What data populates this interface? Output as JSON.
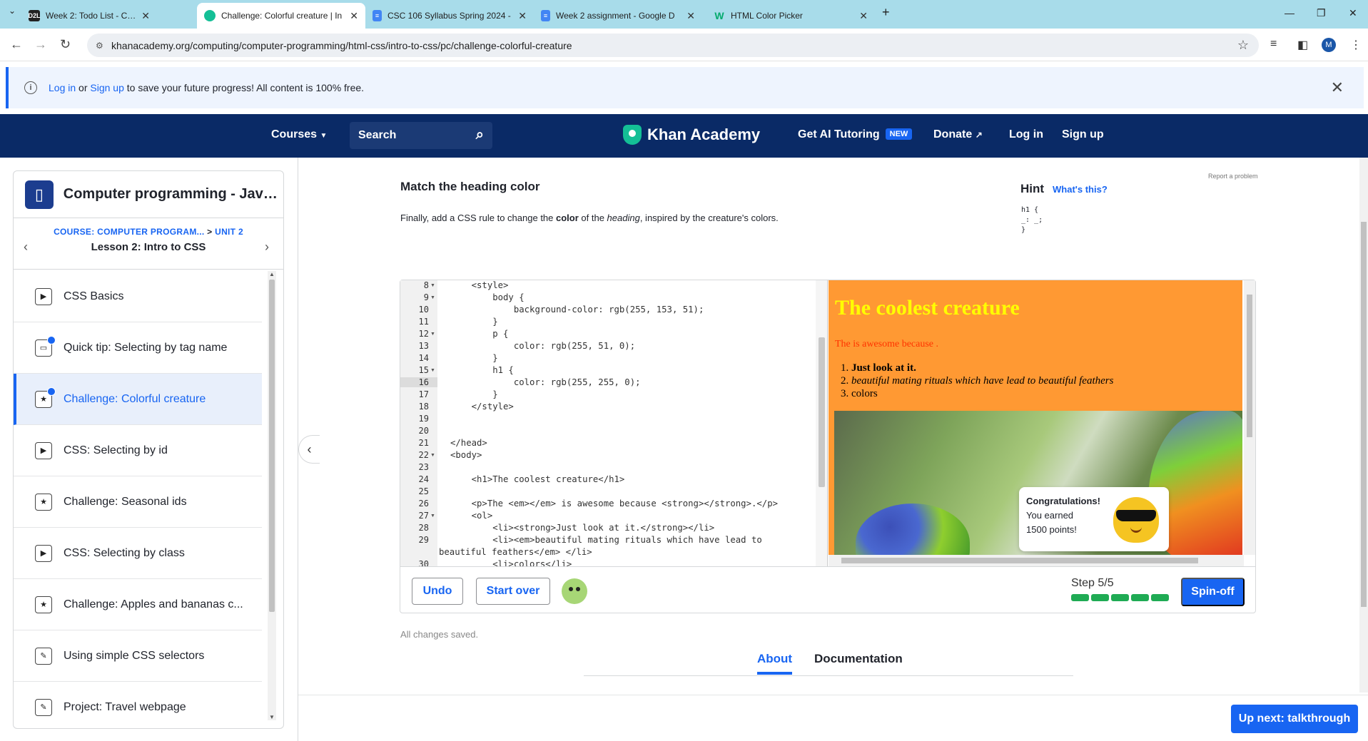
{
  "browser": {
    "tabs": [
      {
        "title": "Week 2: Todo List - CSC106: The",
        "icon": "D2L"
      },
      {
        "title": "Challenge: Colorful creature | In",
        "icon": "ka"
      },
      {
        "title": "CSC 106 Syllabus Spring 2024 -",
        "icon": "doc"
      },
      {
        "title": "Week 2 assignment - Google D",
        "icon": "doc"
      },
      {
        "title": "HTML Color Picker",
        "icon": "W"
      }
    ],
    "new_tab": "+",
    "url": "khanacademy.org/computing/computer-programming/html-css/intro-to-css/pc/challenge-colorful-creature",
    "avatar": "M"
  },
  "banner": {
    "login": "Log in",
    "or": " or ",
    "signup": "Sign up",
    "rest": " to save your future progress! All content is 100% free."
  },
  "nav": {
    "courses": "Courses",
    "search": "Search",
    "logo": "Khan Academy",
    "tutoring": "Get AI Tutoring",
    "new_badge": "NEW",
    "donate": "Donate",
    "login": "Log in",
    "signup": "Sign up"
  },
  "sidebar": {
    "course_title": "Computer programming - JavaScr...",
    "crumb_course": "COURSE: COMPUTER PROGRAM...",
    "crumb_unit": "UNIT 2",
    "crumb_sep": " > ",
    "lesson": "Lesson 2: Intro to CSS",
    "items": [
      {
        "label": "CSS Basics",
        "icon": "play"
      },
      {
        "label": "Quick tip: Selecting by tag name",
        "icon": "doc"
      },
      {
        "label": "Challenge: Colorful creature",
        "icon": "star"
      },
      {
        "label": "CSS: Selecting by id",
        "icon": "play"
      },
      {
        "label": "Challenge: Seasonal ids",
        "icon": "star"
      },
      {
        "label": "CSS: Selecting by class",
        "icon": "play"
      },
      {
        "label": "Challenge: Apples and bananas c...",
        "icon": "star"
      },
      {
        "label": "Using simple CSS selectors",
        "icon": "pencil"
      },
      {
        "label": "Project: Travel webpage",
        "icon": "pencil"
      }
    ]
  },
  "challenge": {
    "heading": "Match the heading color",
    "desc_1": "Finally, add a CSS rule to change the ",
    "desc_color": "color",
    "desc_2": " of the ",
    "desc_heading": "heading",
    "desc_3": ", inspired by the creature's colors.",
    "hint": "Hint",
    "whats_this": "What's this?",
    "hint_code": "h1 {\n_: _;\n}",
    "report": "Report a problem"
  },
  "editor": {
    "lines": [
      {
        "n": "8",
        "text": "    <style>",
        "fold": true
      },
      {
        "n": "9",
        "text": "        body {",
        "fold": true
      },
      {
        "n": "10",
        "text": "            background-color: rgb(255, 153, 51);"
      },
      {
        "n": "11",
        "text": "        }"
      },
      {
        "n": "12",
        "text": "        p {",
        "fold": true
      },
      {
        "n": "13",
        "text": "            color: rgb(255, 51, 0);"
      },
      {
        "n": "14",
        "text": "        }"
      },
      {
        "n": "15",
        "text": "        h1 {",
        "fold": true
      },
      {
        "n": "16",
        "text": "            color: rgb(255, 255, 0);"
      },
      {
        "n": "17",
        "text": "        }"
      },
      {
        "n": "18",
        "text": "    </style>"
      },
      {
        "n": "19",
        "text": ""
      },
      {
        "n": "20",
        "text": ""
      },
      {
        "n": "21",
        "text": "</head>"
      },
      {
        "n": "22",
        "text": "<body>",
        "fold": true
      },
      {
        "n": "23",
        "text": ""
      },
      {
        "n": "24",
        "text": "    <h1>The coolest creature</h1>"
      },
      {
        "n": "25",
        "text": ""
      },
      {
        "n": "26",
        "text": "    <p>The <em></em> is awesome because <strong></strong>.</p>"
      },
      {
        "n": "27",
        "text": "    <ol>",
        "fold": true
      },
      {
        "n": "28",
        "text": "        <li><strong>Just look at it.</strong></li>"
      },
      {
        "n": "29",
        "text": "        <li><em>beautiful mating rituals which have lead to"
      },
      {
        "n": "",
        "text": "beautiful feathers</em> </li>"
      },
      {
        "n": "30",
        "text": "        <li>colors</li>"
      }
    ]
  },
  "preview": {
    "h1": "The coolest creature",
    "p": "The is awesome because .",
    "li1": "Just look at it.",
    "li2": "beautiful mating rituals which have lead to beautiful feathers",
    "li3": "colors",
    "congrats_title": "Congratulations!",
    "congrats_1": "You earned",
    "congrats_2": "1500 points!"
  },
  "toolbar": {
    "undo": "Undo",
    "start_over": "Start over",
    "step": "Step 5/5",
    "progress_done": 5,
    "progress_total": 5,
    "spinoff": "Spin-off"
  },
  "footer": {
    "saved": "All changes saved.",
    "tab_about": "About",
    "tab_docs": "Documentation",
    "up_next": "Up next: talkthrough"
  },
  "colors": {
    "accent": "#1865f2",
    "nav_bg": "#0a2a66",
    "preview_bg": "#ff9933",
    "h1_color": "#ffff00",
    "p_color": "#ff3300"
  }
}
